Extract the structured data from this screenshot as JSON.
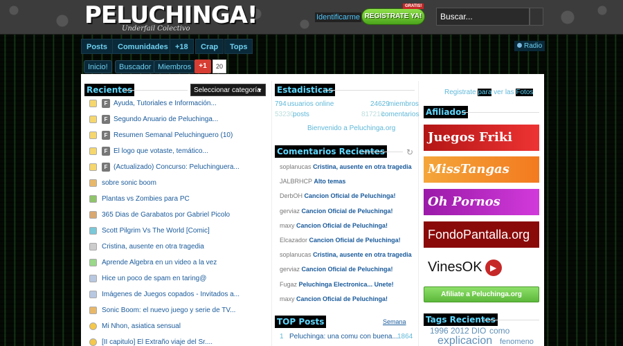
{
  "header": {
    "logo": "PELUCHINGA!",
    "logo_sub": "Underfail Colectivo",
    "login_link": "Identificarme",
    "register_button": "REGISTRATE YA!",
    "register_badge": "GRATIS!",
    "search_placeholder": "Buscar..."
  },
  "nav": {
    "tabs": [
      "Posts",
      "Comunidades",
      "+18",
      "Crap",
      "Tops"
    ],
    "radio": "Radio",
    "subnav": [
      "Inicio!",
      "Buscador",
      "Miembros"
    ],
    "gplus_label": "+1",
    "gplus_count": "20"
  },
  "recientes": {
    "title": "Recientes",
    "category_select": "Seleccionar categoría",
    "posts": [
      {
        "icon": "folder-icon",
        "pin": true,
        "text": "Ayuda, Tutoriales e Información..."
      },
      {
        "icon": "folder-icon",
        "pin": true,
        "text": "Segundo Anuario de Peluchinga..."
      },
      {
        "icon": "folder-icon",
        "pin": true,
        "text": "Resumen Semanal Peluchinguero (10)"
      },
      {
        "icon": "folder-icon",
        "pin": true,
        "text": "El logo que votaste, temático..."
      },
      {
        "icon": "folder-icon",
        "pin": true,
        "text": "(Actualizado) Concurso: Peluchinguera..."
      },
      {
        "icon": "game-icon",
        "pin": false,
        "text": "sobre sonic boom"
      },
      {
        "icon": "plant-icon",
        "pin": false,
        "text": "Plantas vs Zombies para PC"
      },
      {
        "icon": "drawing-icon",
        "pin": false,
        "text": "365 Dias de Garabatos por Gabriel Picolo"
      },
      {
        "icon": "comic-icon",
        "pin": false,
        "text": "Scott Pilgrim Vs The World [Comic]"
      },
      {
        "icon": "news-icon",
        "pin": false,
        "text": "Cristina, ausente en otra tragedia"
      },
      {
        "icon": "flask-icon",
        "pin": false,
        "text": "Aprende Algebra en un video a la vez"
      },
      {
        "icon": "image-icon",
        "pin": false,
        "text": "Hice un poco de spam en taring@"
      },
      {
        "icon": "image-icon",
        "pin": false,
        "text": "Imágenes de Juegos copados - Invitados a..."
      },
      {
        "icon": "game-icon",
        "pin": false,
        "text": "Sonic Boom: el nuevo juego y serie de TV..."
      },
      {
        "icon": "smile-icon",
        "pin": false,
        "text": "Mi Nhon, asiatica sensual"
      },
      {
        "icon": "smile-icon",
        "pin": false,
        "text": "[II capitulo] El Extraño viaje del Sr...."
      }
    ]
  },
  "estadisticas": {
    "title": "Estadisticas",
    "users_online_num": "794",
    "users_online_label": "usuarios online",
    "members_num": "24629",
    "members_label": "miembros",
    "posts_num": "53230",
    "posts_label": "posts",
    "comments_num": "817210",
    "comments_label": "comentarios",
    "welcome": "Bienvenido a Peluchinga.org"
  },
  "comentarios": {
    "title": "Comentarios Recientes",
    "items": [
      {
        "user": "soplanucas",
        "post": "Cristina, ausente en otra tragedia"
      },
      {
        "user": "JALBRHCP",
        "post": "Alto temas"
      },
      {
        "user": "DerbOH",
        "post": "Cancion Oficial de Peluchinga!"
      },
      {
        "user": "gerviaz",
        "post": "Cancion Oficial de Peluchinga!"
      },
      {
        "user": "maxy",
        "post": "Cancion Oficial de Peluchinga!"
      },
      {
        "user": "Elcazador",
        "post": "Cancion Oficial de Peluchinga!"
      },
      {
        "user": "soplanucas",
        "post": "Cristina, ausente en otra tragedia"
      },
      {
        "user": "gerviaz",
        "post": "Cancion Oficial de Peluchinga!"
      },
      {
        "user": "Fugaz",
        "post": "Peluchinga Electronica... Unete!"
      },
      {
        "user": "maxy",
        "post": "Cancion Oficial de Peluchinga!"
      }
    ]
  },
  "top_posts": {
    "title": "TOP Posts",
    "period": "Semana",
    "items": [
      {
        "rank": "1",
        "text": "Peluchinga: una comu con buena...",
        "score": "1864"
      }
    ]
  },
  "sidebar": {
    "register_prefix": "Registrate",
    "register_para": "para",
    "register_ver": "ver las",
    "register_fotos": "Fotos",
    "afiliados_title": "Afiliados",
    "banners": [
      "Juegos Friki",
      "MissTangas",
      "Oh Pornos",
      "FondoPantalla.org",
      "VinesOK"
    ],
    "afiliate_button": "Afiliate a Peluchinga.org",
    "tags_title": "Tags Recientes",
    "tags": [
      "1996",
      "2012",
      "DIO",
      "como",
      "explicacion",
      "fenomeno"
    ]
  },
  "colors": {
    "accent_cyan": "#5fd8ff",
    "link_blue": "#1a5a9a",
    "register_green": "#4aa41a"
  }
}
